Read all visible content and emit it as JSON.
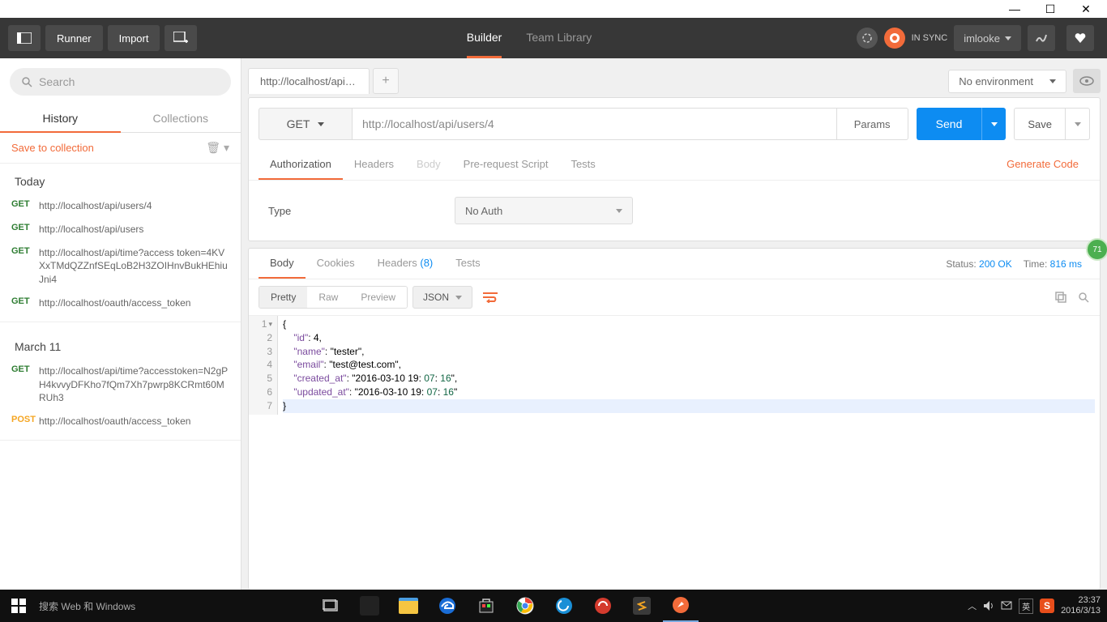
{
  "titlebar": {
    "minimize": "—",
    "maximize": "☐",
    "close": "✕"
  },
  "topbar": {
    "runner": "Runner",
    "import": "Import",
    "builder": "Builder",
    "team_library": "Team Library",
    "sync": "IN SYNC",
    "user": "imlooke"
  },
  "sidebar": {
    "search_placeholder": "Search",
    "history": "History",
    "collections": "Collections",
    "save_to_collection": "Save to collection",
    "sections": [
      {
        "header": "Today",
        "items": [
          {
            "method": "GET",
            "url": "http://localhost/api/users/4"
          },
          {
            "method": "GET",
            "url": "http://localhost/api/users"
          },
          {
            "method": "GET",
            "url": "http://localhost/api/time?access token=4KVXxTMdQZZnfSEqLoB2H3ZOIHnvBukHEhiuJni4"
          },
          {
            "method": "GET",
            "url": "http://localhost/oauth/access_token"
          }
        ]
      },
      {
        "header": "March 11",
        "items": [
          {
            "method": "GET",
            "url": "http://localhost/api/time?accesstoken=N2gPH4kvvyDFKho7fQm7Xh7pwrp8KCRmt60MRUh3"
          },
          {
            "method": "POST",
            "url": "http://localhost/oauth/access_token"
          }
        ]
      }
    ]
  },
  "request": {
    "tab_name": "http://localhost/api/user",
    "env": "No environment",
    "method": "GET",
    "url": "http://localhost/api/users/4",
    "params": "Params",
    "send": "Send",
    "save": "Save",
    "tabs": {
      "auth": "Authorization",
      "headers": "Headers",
      "body": "Body",
      "pre": "Pre-request Script",
      "tests": "Tests"
    },
    "gen_code": "Generate Code",
    "auth_type_label": "Type",
    "auth_type": "No Auth"
  },
  "response": {
    "tabs": {
      "body": "Body",
      "cookies": "Cookies",
      "headers": "Headers",
      "header_count": "(8)",
      "tests": "Tests"
    },
    "status_label": "Status:",
    "status": "200 OK",
    "time_label": "Time:",
    "time": "816 ms",
    "pretty": "Pretty",
    "raw": "Raw",
    "preview": "Preview",
    "format": "JSON",
    "json_lines": [
      {
        "n": "1",
        "t": "{",
        "fold": true
      },
      {
        "n": "2",
        "t": "    \"id\": 4,"
      },
      {
        "n": "3",
        "t": "    \"name\": \"tester\","
      },
      {
        "n": "4",
        "t": "    \"email\": \"test@test.com\","
      },
      {
        "n": "5",
        "t": "    \"created_at\": \"2016-03-10 19:07:16\","
      },
      {
        "n": "6",
        "t": "    \"updated_at\": \"2016-03-10 19:07:16\""
      },
      {
        "n": "7",
        "t": "}",
        "hl": true
      }
    ]
  },
  "badge": "71",
  "taskbar": {
    "search": "搜索 Web 和 Windows",
    "ime": "英",
    "time": "23:37",
    "date": "2016/3/13"
  }
}
